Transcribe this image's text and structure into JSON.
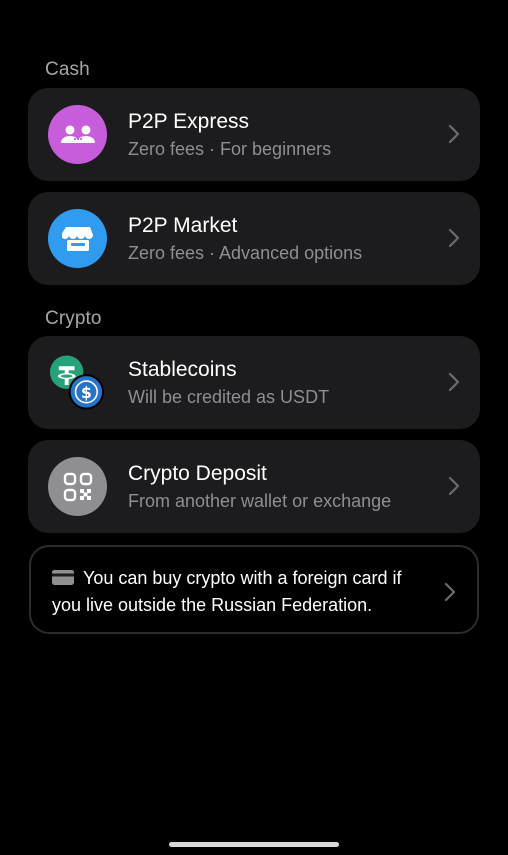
{
  "sections": {
    "cash_label": "Cash",
    "crypto_label": "Crypto"
  },
  "options": [
    {
      "title": "P2P Express",
      "subtitle": "Zero fees · For beginners",
      "icon": "users-icon",
      "icon_color": "#c85ddb"
    },
    {
      "title": "P2P Market",
      "subtitle": "Zero fees · Advanced options",
      "icon": "store-icon",
      "icon_color": "#2f9cf0"
    },
    {
      "title": "Stablecoins",
      "subtitle": "Will be credited as USDT",
      "icon": "stablecoins-icon",
      "icon_color": "#26a17b"
    },
    {
      "title": "Crypto Deposit",
      "subtitle": "From another wallet or exchange",
      "icon": "qr-code-icon",
      "icon_color": "#8e8e93"
    }
  ],
  "info": {
    "text": "You can buy crypto with a foreign card if you live outside the Russian Federation.",
    "icon": "credit-card-icon"
  },
  "colors": {
    "background": "#000000",
    "card": "#1c1c1e",
    "secondary_text": "#8e8e93",
    "section_label": "#a6a6a6"
  }
}
